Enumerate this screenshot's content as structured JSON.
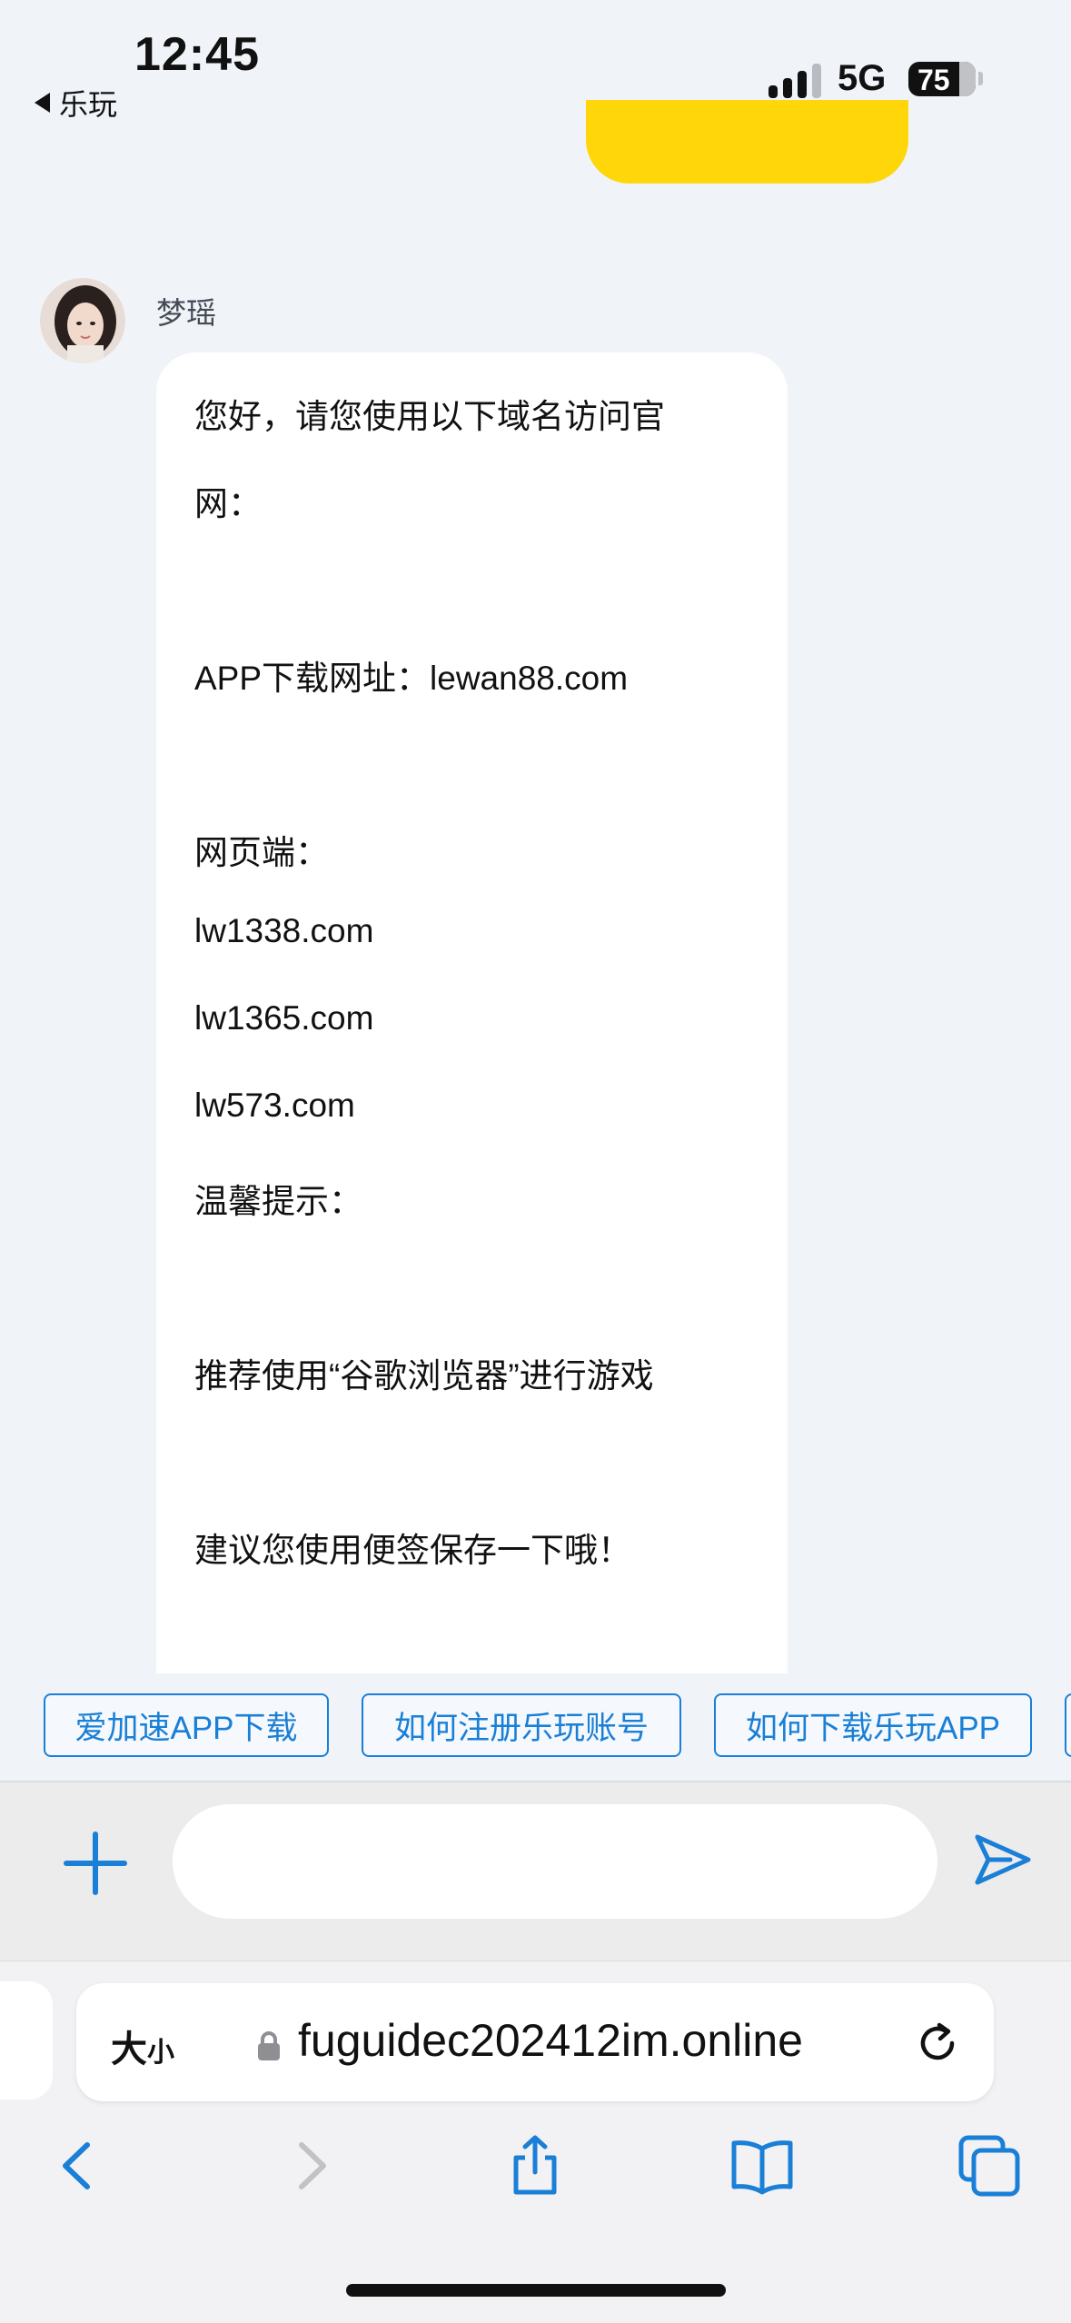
{
  "status_bar": {
    "time": "12:45",
    "back_app": "乐玩",
    "network": "5G",
    "battery": "75"
  },
  "chat": {
    "agent_name": "梦瑶",
    "message_lines": [
      "您好，请您使用以下域名访问官",
      "网：",
      "APP下载网址：lewan88.com",
      "网页端：",
      "lw1338.com",
      "lw1365.com",
      "lw573.com",
      "温馨提示：",
      "推荐使用“谷歌浏览器”进行游戏",
      "建议您使用便签保存一下哦！"
    ]
  },
  "quick_replies": [
    "爱加速APP下载",
    "如何注册乐玩账号",
    "如何下载乐玩APP"
  ],
  "input": {
    "placeholder": ""
  },
  "safari": {
    "text_size": "大",
    "text_size_small": "小",
    "url": "fuguidec202412im.online"
  },
  "colors": {
    "accent": "#1a7fd6",
    "yellow": "#ffd60a",
    "background": "#f0f4f9"
  }
}
